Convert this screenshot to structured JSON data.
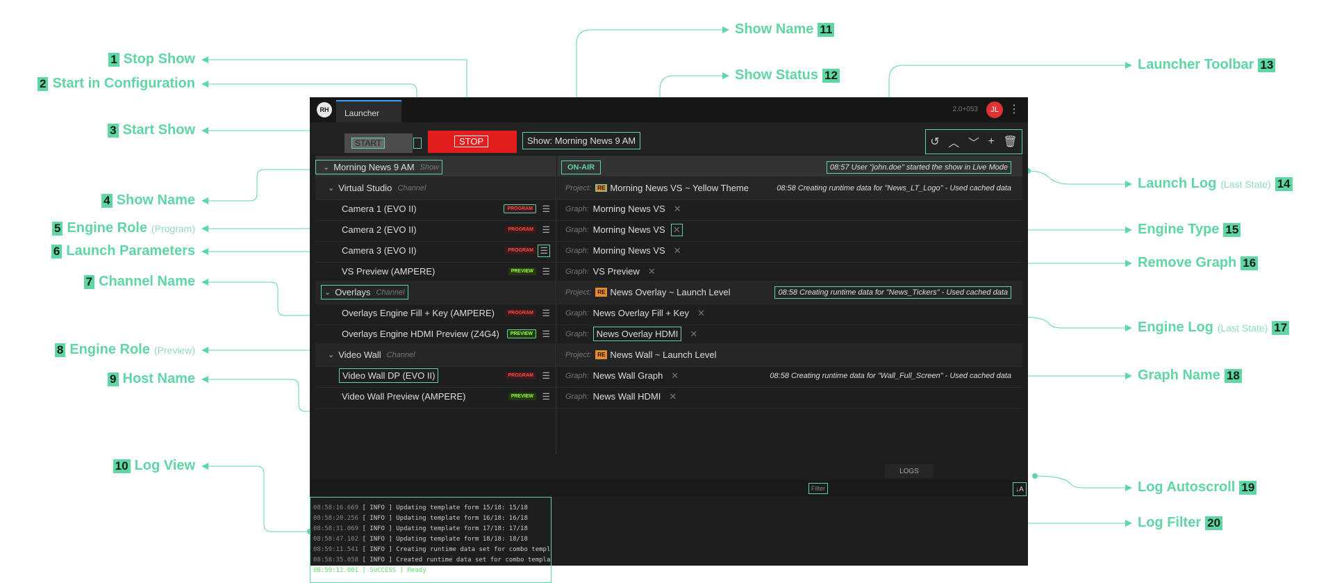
{
  "annotations": {
    "left": [
      {
        "num": "1",
        "label": "Stop Show",
        "sub": ""
      },
      {
        "num": "2",
        "label": "Start in Configuration",
        "sub": ""
      },
      {
        "num": "3",
        "label": "Start Show",
        "sub": ""
      },
      {
        "num": "4",
        "label": "Show Name",
        "sub": ""
      },
      {
        "num": "5",
        "label": "Engine Role",
        "sub": "(Program)"
      },
      {
        "num": "6",
        "label": "Launch Parameters",
        "sub": ""
      },
      {
        "num": "7",
        "label": "Channel Name",
        "sub": ""
      },
      {
        "num": "8",
        "label": "Engine Role",
        "sub": "(Preview)"
      },
      {
        "num": "9",
        "label": "Host Name",
        "sub": ""
      },
      {
        "num": "10",
        "label": "Log View",
        "sub": ""
      }
    ],
    "right": [
      {
        "num": "11",
        "label": "Show Name",
        "sub": ""
      },
      {
        "num": "12",
        "label": "Show Status",
        "sub": ""
      },
      {
        "num": "13",
        "label": "Launcher Toolbar",
        "sub": ""
      },
      {
        "num": "14",
        "label": "Launch Log",
        "sub": "(Last State)"
      },
      {
        "num": "15",
        "label": "Engine Type",
        "sub": ""
      },
      {
        "num": "16",
        "label": "Remove Graph",
        "sub": ""
      },
      {
        "num": "17",
        "label": "Engine Log",
        "sub": "(Last State)"
      },
      {
        "num": "18",
        "label": "Graph Name",
        "sub": ""
      },
      {
        "num": "19",
        "label": "Log Autoscroll",
        "sub": ""
      },
      {
        "num": "20",
        "label": "Log Filter",
        "sub": ""
      }
    ]
  },
  "app": {
    "logo": "RH",
    "tab": "Launcher",
    "version": "2.0+053",
    "avatar": "JL",
    "kebab_icon": "more-vertical-icon"
  },
  "toolbar": {
    "start_label": "START",
    "stop_label": "STOP",
    "show_label": "Show: Morning News 9 AM"
  },
  "tree": {
    "show": {
      "name": "Morning News 9 AM",
      "sub": "Show"
    },
    "channels": [
      {
        "name": "Virtual Studio",
        "sub": "Channel",
        "engines": [
          {
            "name": "Camera 1 (EVO II)",
            "role": "PROGRAM"
          },
          {
            "name": "Camera 2 (EVO II)",
            "role": "PROGRAM"
          },
          {
            "name": "Camera 3 (EVO II)",
            "role": "PROGRAM"
          },
          {
            "name": "VS Preview (AMPERE)",
            "role": "PREVIEW"
          }
        ]
      },
      {
        "name": "Overlays",
        "sub": "Channel",
        "engines": [
          {
            "name": "Overlays Engine Fill + Key  (AMPERE)",
            "role": "PROGRAM"
          },
          {
            "name": "Overlays Engine HDMI Preview (Z4G4)",
            "role": "PREVIEW"
          }
        ]
      },
      {
        "name": "Video Wall",
        "sub": "Channel",
        "engines": [
          {
            "name": "Video Wall DP (EVO II)",
            "role": "PROGRAM"
          },
          {
            "name": "Video Wall Preview  (AMPERE)",
            "role": "PREVIEW"
          }
        ]
      }
    ]
  },
  "details": {
    "status": "ON-AIR",
    "launch_log": "08:57 User \"john.doe\" started the show in Live Mode",
    "project_label": "Project:",
    "graph_label": "Graph:",
    "engine_type": "RE",
    "rows": [
      {
        "project": "Morning News VS ~ Yellow Theme",
        "log": "08:58 Creating runtime data for \"News_LT_Logo\" - Used cached data"
      },
      {
        "graph": "Morning News VS"
      },
      {
        "graph": "Morning News VS"
      },
      {
        "graph": "Morning News VS"
      },
      {
        "graph": "VS Preview"
      },
      {
        "project": "News Overlay ~ Launch Level",
        "log": "08:58 Creating runtime data for \"News_Tickers\" - Used cached data"
      },
      {
        "graph": "News Overlay Fill + Key"
      },
      {
        "graph": "News Overlay HDMI"
      },
      {
        "project": "News Wall ~ Launch Level"
      },
      {
        "graph": "News Wall Graph",
        "log": "08:58 Creating runtime data for \"Wall_Full_Screen\" - Used cached data"
      },
      {
        "graph": "News Wall HDMI"
      }
    ]
  },
  "logs": {
    "tab": "LOGS",
    "filter": "Filter",
    "autoscroll": "↓A",
    "lines": [
      {
        "ts": "08:58:16.669",
        "level": "[   INFO   ]",
        "msg": "Updating template form 15/18: 15/18"
      },
      {
        "ts": "08:58:20.256",
        "level": "[   INFO   ]",
        "msg": "Updating template form 16/18: 16/18"
      },
      {
        "ts": "08:58:31.069",
        "level": "[   INFO   ]",
        "msg": "Updating template form 17/18: 17/18"
      },
      {
        "ts": "08:58:47.102",
        "level": "[   INFO   ]",
        "msg": "Updating template form 18/18: 18/18"
      },
      {
        "ts": "08:59:11.541",
        "level": "[   INFO   ]",
        "msg": "Creating runtime data set for combo templates"
      },
      {
        "ts": "08:58:35.058",
        "level": "[   INFO   ]",
        "msg": "Created runtime data set for combo templates"
      },
      {
        "ts": "08:59:12.001",
        "level": "[ SUCCESS ]",
        "msg": "Ready"
      }
    ]
  }
}
